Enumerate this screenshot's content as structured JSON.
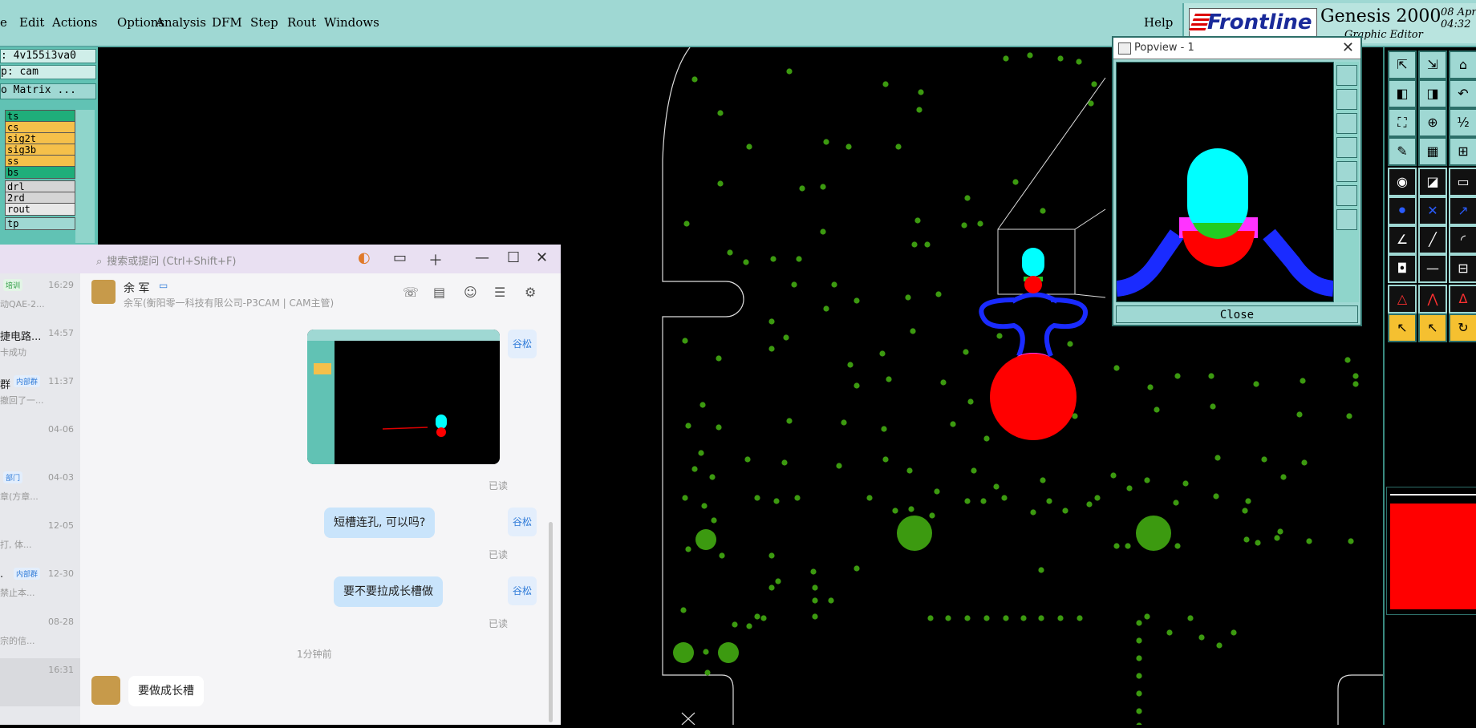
{
  "menubar": {
    "items": [
      "e",
      "Edit",
      "Actions",
      "Options",
      "Analysis",
      "DFM",
      "Step",
      "Rout",
      "Windows"
    ],
    "help": "Help"
  },
  "brand": {
    "logo": "Frontline",
    "title": "Genesis 2000",
    "subtitle": "Graphic Editor",
    "date": "08 Apr",
    "time": "04:32"
  },
  "left_panel": {
    "job": ": 4v155i3va0",
    "step": "p: cam",
    "matrix": "o Matrix ...",
    "layers": [
      {
        "name": "ts",
        "color": "#1fae7a"
      },
      {
        "name": "cs",
        "color": "#f5c04a"
      },
      {
        "name": "sig2t",
        "color": "#f5c04a"
      },
      {
        "name": "sig3b",
        "color": "#f5c04a"
      },
      {
        "name": "ss",
        "color": "#f5c04a"
      },
      {
        "name": "bs",
        "color": "#1fae7a"
      },
      {
        "name": "drl",
        "color": "#d5d5d5"
      },
      {
        "name": "2rd",
        "color": "#d5d5d5"
      },
      {
        "name": "rout",
        "color": "#e8e8e8"
      },
      {
        "name": "tp",
        "color": "#9fd8d3"
      }
    ]
  },
  "popview": {
    "title": "Popview - 1",
    "close_label": "Close"
  },
  "chat": {
    "search_placeholder": "搜索或提问 (Ctrl+Shift+F)",
    "conversations": [
      {
        "name": "",
        "time": "16:29",
        "preview": "动QAE-2...",
        "badge": "培训"
      },
      {
        "name": "捷电路...",
        "time": "14:57",
        "preview": "卡成功",
        "badge": ""
      },
      {
        "name": "群",
        "time": "11:37",
        "preview": "撤回了一...",
        "badge": "内部群"
      },
      {
        "name": "",
        "time": "04-06",
        "preview": "",
        "badge": ""
      },
      {
        "name": "",
        "time": "04-03",
        "preview": "章(方章...",
        "badge": "部门"
      },
      {
        "name": "",
        "time": "12-05",
        "preview": "打, 体...",
        "badge": ""
      },
      {
        "name": ".",
        "time": "12-30",
        "preview": "禁止本...",
        "badge": "内部群"
      },
      {
        "name": "",
        "time": "08-28",
        "preview": "宗的信...",
        "badge": ""
      },
      {
        "name": "",
        "time": "16:31",
        "preview": "",
        "badge": ""
      }
    ],
    "contact_name": "余 军",
    "contact_org": "余军(衡阳零一科技有限公司-P3CAM | CAM主管)",
    "self_avatar": "谷松",
    "messages": [
      {
        "type": "image",
        "status": "已读"
      },
      {
        "type": "text",
        "text": "短槽连孔, 可以吗?",
        "status": "已读"
      },
      {
        "type": "text",
        "text": "要不要拉成长槽做",
        "status": "已读"
      }
    ],
    "timestamp": "1分钟前",
    "reply": "要做成长槽"
  }
}
